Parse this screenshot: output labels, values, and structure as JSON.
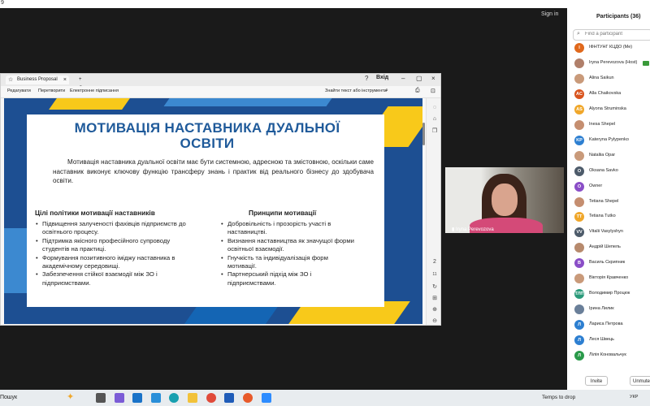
{
  "system": {
    "corner_digit": "9"
  },
  "zoom": {
    "sign_in": "Sign in"
  },
  "pdf_viewer": {
    "tab_title": "Business Proposal",
    "new_tab": "+ Створити",
    "signin_label": "Вхід",
    "toolbar": {
      "edit": "Редагувати",
      "convert": "Перетворити",
      "sign": "Електронне підписання",
      "find": "Знайти текст або інструменти"
    },
    "page_number": "2",
    "page_total": "11"
  },
  "slide": {
    "title": "МОТИВАЦІЯ НАСТАВНИКА ДУАЛЬНОЇ ОСВІТИ",
    "intro": "Мотивація наставника дуальної освіти має бути системною, адресною та змістовною, оскільки саме наставник виконує ключову функцію трансферу знань і практик від реального бізнесу до здобувача освіти.",
    "left_heading": "Цілі політики мотивації наставників",
    "left_items": [
      "Підвищення залученості фахівців підприємств до освітнього процесу.",
      "Підтримка якісного професійного супроводу студентів на практиці.",
      "Формування позитивного іміджу наставника в академічному середовищі.",
      "Забезпечення стійкої взаємодії між ЗО і підприємствами."
    ],
    "right_heading": "Принципи мотивації",
    "right_items": [
      "Добровільність і прозорість участі в наставництві.",
      "Визнання наставництва як значущої форми освітньої взаємодії.",
      "Гнучкість та індивідуалізація форм мотивації.",
      "Партнерський підхід між ЗО і підприємствами."
    ]
  },
  "video": {
    "name": "Iryna Perevozova"
  },
  "participants": {
    "title": "Participants (36)",
    "search_placeholder": "Find a participant",
    "list": [
      {
        "initials": "І",
        "name": "ІФНТУНГ КЦДО (Me)",
        "color": "#e0681c"
      },
      {
        "initials": "",
        "name": "Iryna Perevozova (Host)",
        "color": "#b07f6a"
      },
      {
        "initials": "",
        "name": "Alina Saikun",
        "color": "#c99a7a"
      },
      {
        "initials": "AC",
        "name": "Alla Chaikovska",
        "color": "#d9541e"
      },
      {
        "initials": "AS",
        "name": "Alyona Struminska",
        "color": "#f0a72a"
      },
      {
        "initials": "",
        "name": "Inesa Shepel",
        "color": "#c58e70"
      },
      {
        "initials": "KP",
        "name": "Kateryna Pylypenko",
        "color": "#2d7fd1"
      },
      {
        "initials": "",
        "name": "Nataliia Opar",
        "color": "#c99a7a"
      },
      {
        "initials": "O",
        "name": "Oksana Savko",
        "color": "#4d5b6a"
      },
      {
        "initials": "O",
        "name": "Owner",
        "color": "#8a4ec7"
      },
      {
        "initials": "",
        "name": "Tetiana Shepel",
        "color": "#c58e70"
      },
      {
        "initials": "TT",
        "name": "Tetiana Tutko",
        "color": "#f0a72a"
      },
      {
        "initials": "VV",
        "name": "Vitalii Vasylyshyn",
        "color": "#4d5b6a"
      },
      {
        "initials": "",
        "name": "Андрій Шепель",
        "color": "#b78a6d"
      },
      {
        "initials": "В",
        "name": "Василь Скрипник",
        "color": "#8a4ec7"
      },
      {
        "initials": "",
        "name": "Вікторія Кравченко",
        "color": "#c99a7a"
      },
      {
        "initials": "ТЛП",
        "name": "Володимир Процюк",
        "color": "#2a9a7a"
      },
      {
        "initials": "",
        "name": "Ірина Лилик",
        "color": "#6a7f99"
      },
      {
        "initials": "Л",
        "name": "Лариса Петрова",
        "color": "#2d7fd1"
      },
      {
        "initials": "Л",
        "name": "Леся Швець",
        "color": "#2d7fd1"
      },
      {
        "initials": "Л",
        "name": "Лілія Коновальчук",
        "color": "#2a9a4a"
      }
    ],
    "invite": "Invite",
    "unmute": "Unmute"
  },
  "taskbar": {
    "search": "Пошук",
    "weather": "Temps to drop",
    "lang": "УКР"
  },
  "colors": {
    "slide_blue": "#1d4f92",
    "slide_yellow": "#f8c91a",
    "title_blue": "#1f5a9a",
    "zoom_green": "#3a9a3a"
  }
}
